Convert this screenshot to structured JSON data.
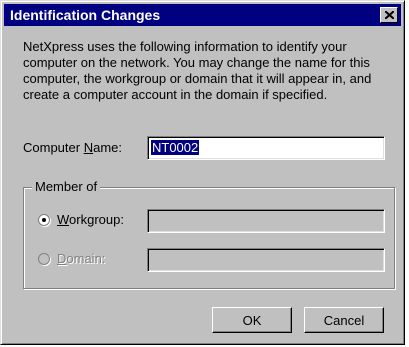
{
  "window": {
    "title": "Identification Changes",
    "close_icon": "close-icon"
  },
  "description": "NetXpress uses the following information to identify your computer on the network. You may change the name for this computer, the workgroup or domain that it will appear in, and create a computer account in the domain if specified.",
  "computer_name": {
    "label_pre": "Computer ",
    "label_mnemonic": "N",
    "label_post": "ame:",
    "value": "NT0002"
  },
  "member_of": {
    "group_label": "Member of",
    "workgroup": {
      "label_mnemonic": "W",
      "label_rest": "orkgroup:",
      "selected": true,
      "value": ""
    },
    "domain": {
      "label_mnemonic": "D",
      "label_rest": "omain:",
      "selected": false,
      "enabled": false,
      "value": ""
    }
  },
  "buttons": {
    "ok": "OK",
    "cancel": "Cancel"
  }
}
